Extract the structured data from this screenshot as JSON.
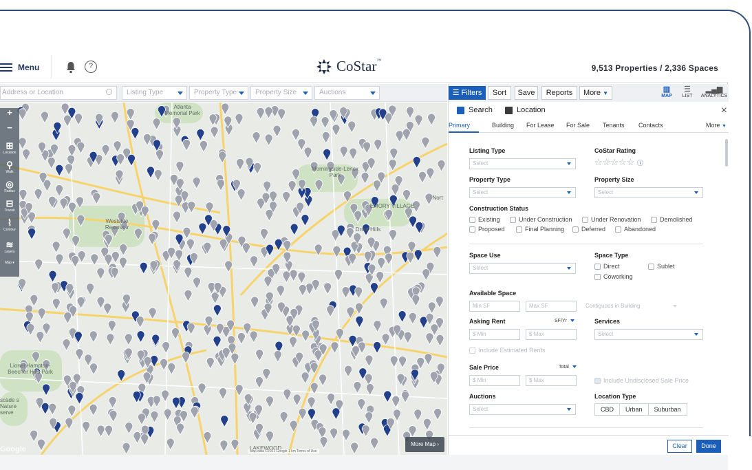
{
  "header": {
    "menu_label": "Menu",
    "help_glyph": "?",
    "logo_text": "CoStar",
    "logo_tm": "™",
    "counts": "9,513 Properties / 2,336 Spaces"
  },
  "filterbar": {
    "address_placeholder": "Address or Location",
    "listing_type": "Listing Type",
    "property_type": "Property Type",
    "property_size": "Property Size",
    "auctions": "Auctions"
  },
  "toolbar": {
    "filters": "Filters",
    "sort": "Sort",
    "save": "Save",
    "reports": "Reports",
    "more": "More",
    "views": [
      {
        "label": "MAP",
        "icon": "map-icon",
        "active": true
      },
      {
        "label": "LIST",
        "icon": "list-icon",
        "active": false
      },
      {
        "label": "ANALYTICS",
        "icon": "analytics-icon",
        "active": false
      }
    ]
  },
  "search_header": {
    "search": "Search",
    "location": "Location",
    "close": "×"
  },
  "tabs": [
    "Primary",
    "Building",
    "For Lease",
    "For Sale",
    "Tenants",
    "Contacts",
    "More"
  ],
  "form": {
    "listing_type_label": "Listing Type",
    "listing_type_value": "Select",
    "costar_rating_label": "CoStar Rating",
    "stars": "☆☆☆☆☆",
    "info_glyph": "ⓘ",
    "property_type_label": "Property Type",
    "property_type_value": "Select",
    "property_size_label": "Property Size",
    "property_size_value": "Select",
    "construction_status_label": "Construction Status",
    "construction_status": [
      "Existing",
      "Under Construction",
      "Under Renovation",
      "Demolished",
      "Proposed",
      "Final Planning",
      "Deferred",
      "Abandoned"
    ],
    "space_use_label": "Space Use",
    "space_use_value": "Select",
    "space_type_label": "Space Type",
    "space_type": [
      "Direct",
      "Sublet",
      "Coworking"
    ],
    "available_space_label": "Available Space",
    "min_sf": "Min SF",
    "max_sf": "Max SF",
    "contiguous": "Contiguous in Building",
    "asking_rent_label": "Asking Rent",
    "rent_unit": "SF/Yr",
    "rent_min": "$ Min",
    "rent_max": "$ Max",
    "services_label": "Services",
    "services_value": "Select",
    "include_estimated": "Include Estimated Rents",
    "sale_price_label": "Sale Price",
    "sale_unit": "Total",
    "sale_min": "$ Min",
    "sale_max": "$ Max",
    "include_undisclosed": "Include Undisclosed Sale Price",
    "auctions_label": "Auctions",
    "auctions_value": "Select",
    "location_type_label": "Location Type",
    "location_types": [
      "CBD",
      "Urban",
      "Suburban"
    ]
  },
  "footer": {
    "clear": "Clear",
    "done": "Done"
  },
  "map": {
    "labels": [
      "Atlanta Memorial Park",
      "Westside Reservoir",
      "Druid Hills",
      "EMORY VILLAGE",
      "Lionel Hampton-Beecher Hills Park",
      "Morningside-Lenox Park",
      "Nort",
      "scade s Nature serve",
      "LAKEWOOD"
    ],
    "toolbar": [
      {
        "icon": "zoom-in-icon",
        "label": ""
      },
      {
        "icon": "zoom-out-icon",
        "label": ""
      },
      {
        "icon": "location-icon",
        "label": "Location"
      },
      {
        "icon": "walk-icon",
        "label": "Walk"
      },
      {
        "icon": "radius-icon",
        "label": "Radius"
      },
      {
        "icon": "transit-icon",
        "label": "Transit"
      },
      {
        "icon": "contour-icon",
        "label": "Contour"
      },
      {
        "icon": "layers-icon",
        "label": "Layers"
      },
      {
        "icon": "map-type-icon",
        "label": "Map ▾"
      }
    ],
    "more_map": "More Map",
    "attribution": "Map data ©2021 Google   1 km   Terms of Use",
    "google": "Google",
    "colors": {
      "pin_gray": "#9ea3ad",
      "pin_navy": "#23408a",
      "road": "#f7d36b",
      "park": "#cfe3c4"
    }
  }
}
